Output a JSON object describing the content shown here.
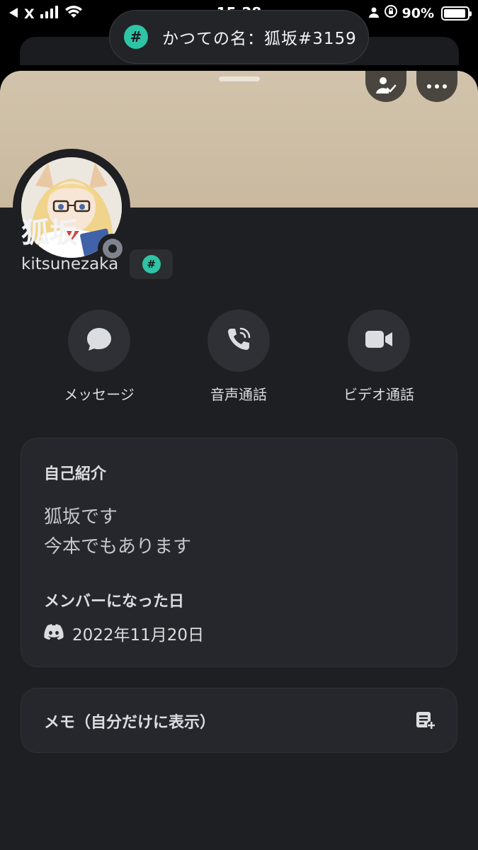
{
  "status_bar": {
    "back_app": "X",
    "time": "15:28",
    "battery": "90%"
  },
  "toast": {
    "text": "かつての名：狐坂#3159"
  },
  "profile": {
    "display_name": "狐坂",
    "username": "kitsunezaka",
    "presence": "offline"
  },
  "actions": [
    {
      "label": "メッセージ",
      "icon": "chat-bubble-icon"
    },
    {
      "label": "音声通話",
      "icon": "phone-icon"
    },
    {
      "label": "ビデオ通話",
      "icon": "video-camera-icon"
    }
  ],
  "bio_card": {
    "title": "自己紹介",
    "lines": [
      "狐坂です",
      "今本でもあります"
    ],
    "member_since_title": "メンバーになった日",
    "member_since_date": "2022年11月20日"
  },
  "memo_card": {
    "label": "メモ（自分だけに表示）"
  },
  "colors": {
    "background": "#1e1f22",
    "card": "#26272c",
    "banner": "#d2c3ac",
    "accent_teal": "#2ec4a6"
  }
}
